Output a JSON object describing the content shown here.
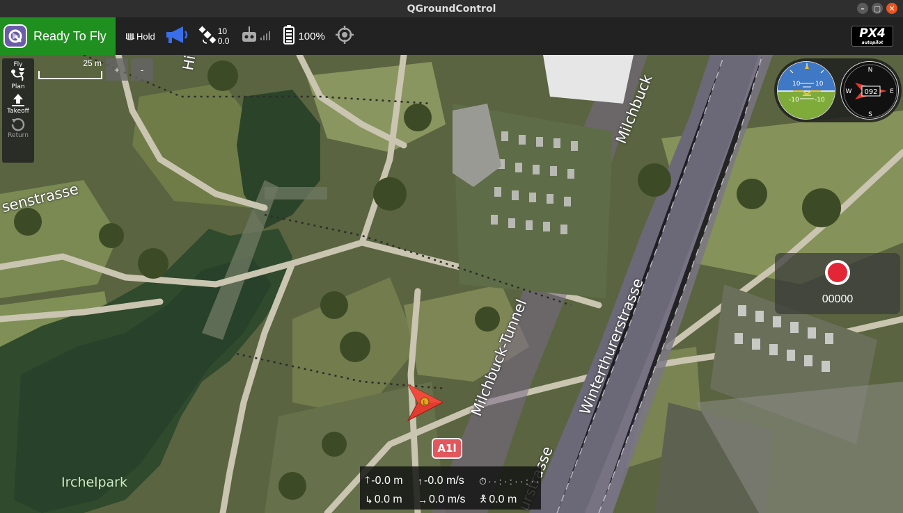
{
  "window": {
    "title": "QGroundControl",
    "controls": [
      "minimize",
      "maximize",
      "close"
    ]
  },
  "toolbar": {
    "status": "Ready To Fly",
    "flight_mode": "Hold",
    "satellites": {
      "count": "10",
      "hdop": "0.0"
    },
    "battery": "100%",
    "icons": [
      "qgc-logo-icon",
      "hold-mode-icon",
      "megaphone-icon",
      "satellite-icon",
      "rc-transmitter-icon",
      "signal-bars-icon",
      "battery-icon",
      "crosshair-icon",
      "px4-logo"
    ],
    "brand": {
      "name": "PX4",
      "sub": "autopilot"
    },
    "colors": {
      "ready": "#1f8f1f",
      "megaphone": "#3a6ee8"
    }
  },
  "toolstrip": {
    "header": "Fly",
    "buttons": [
      {
        "label": "Plan",
        "icon": "plan-route-icon",
        "enabled": true
      },
      {
        "label": "Takeoff",
        "icon": "takeoff-icon",
        "enabled": true
      },
      {
        "label": "Return",
        "icon": "return-icon",
        "enabled": false
      }
    ]
  },
  "map": {
    "scale": "25 m",
    "zoom_in": "+",
    "zoom_out": "-",
    "labels": {
      "street_left": "senstrasse",
      "street_top": "Hi",
      "milchbuck": "Milchbuck",
      "tunnel": "Milchbuck-Tunnel",
      "winterthurer": "Winterthurerstrasse",
      "lower": "urstrasse",
      "park": "Irchelpark"
    },
    "highway_shield": "A1l",
    "vehicle_marker": "L"
  },
  "instruments": {
    "attitude_ticks": [
      "10",
      "10",
      "-10",
      "-10"
    ],
    "heading": "092",
    "compass": [
      "N",
      "E",
      "S",
      "W"
    ]
  },
  "video": {
    "record_time": "00000"
  },
  "telemetry": {
    "altitude": "-0.0 m",
    "vertical_speed": "-0.0 m/s",
    "flight_time": "· · : · : · · : · ·",
    "distance": "0.0 m",
    "ground_speed": "0.0 m/s",
    "home_distance": "0.0 m"
  }
}
